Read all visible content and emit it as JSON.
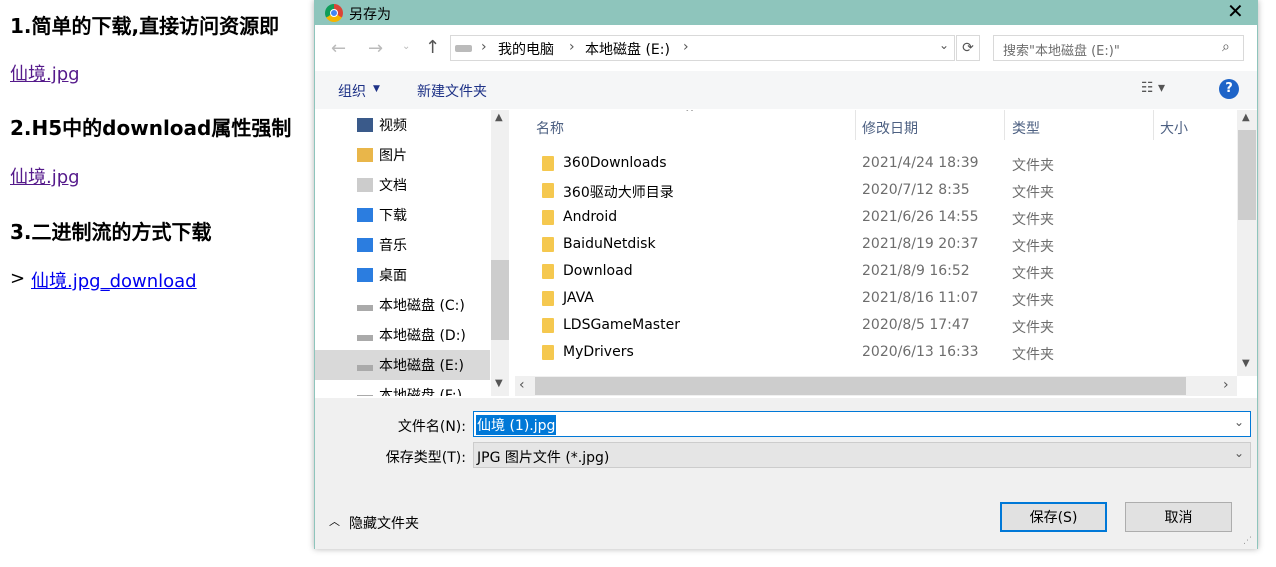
{
  "page": {
    "h1": "1.简单的下载,直接访问资源即",
    "link1": "仙境.jpg",
    "h2": "2.H5中的download属性强制",
    "link2": "仙境.jpg",
    "h3": "3.二进制流的方式下载",
    "prefix": ">",
    "link3": "仙境.jpg_download"
  },
  "dialog": {
    "title": "另存为",
    "breadcrumb": [
      "我的电脑",
      "本地磁盘 (E:)"
    ],
    "search_placeholder": "搜索\"本地磁盘 (E:)\"",
    "toolbar": {
      "organize": "组织",
      "new_folder": "新建文件夹",
      "help": "?"
    },
    "nav": [
      {
        "label": "视频",
        "icon": "video-icon"
      },
      {
        "label": "图片",
        "icon": "pictures-icon"
      },
      {
        "label": "文档",
        "icon": "documents-icon"
      },
      {
        "label": "下载",
        "icon": "downloads-icon"
      },
      {
        "label": "音乐",
        "icon": "music-icon"
      },
      {
        "label": "桌面",
        "icon": "desktop-icon"
      },
      {
        "label": "本地磁盘 (C:)",
        "icon": "drive-icon"
      },
      {
        "label": "本地磁盘 (D:)",
        "icon": "drive-icon"
      },
      {
        "label": "本地磁盘 (E:)",
        "icon": "drive-icon",
        "selected": true
      },
      {
        "label": "本地磁盘 (F:)",
        "icon": "drive-icon"
      }
    ],
    "columns": [
      "名称",
      "修改日期",
      "类型",
      "大小"
    ],
    "files": [
      {
        "name": "360Downloads",
        "date": "2021/4/24 18:39",
        "type": "文件夹"
      },
      {
        "name": "360驱动大师目录",
        "date": "2020/7/12 8:35",
        "type": "文件夹"
      },
      {
        "name": "Android",
        "date": "2021/6/26 14:55",
        "type": "文件夹"
      },
      {
        "name": "BaiduNetdisk",
        "date": "2021/8/19 20:37",
        "type": "文件夹"
      },
      {
        "name": "Download",
        "date": "2021/8/9 16:52",
        "type": "文件夹"
      },
      {
        "name": "JAVA",
        "date": "2021/8/16 11:07",
        "type": "文件夹"
      },
      {
        "name": "LDSGameMaster",
        "date": "2020/8/5 17:47",
        "type": "文件夹"
      },
      {
        "name": "MyDrivers",
        "date": "2020/6/13 16:33",
        "type": "文件夹"
      }
    ],
    "filename_label": "文件名(N):",
    "filename_value": "仙境 (1).jpg",
    "filetype_label": "保存类型(T):",
    "filetype_value": "JPG 图片文件 (*.jpg)",
    "hide_folders": "隐藏文件夹",
    "save": "保存(S)",
    "cancel": "取消",
    "colors": {
      "titlebar": "#8ec5bc",
      "selection": "#0078d7"
    }
  }
}
